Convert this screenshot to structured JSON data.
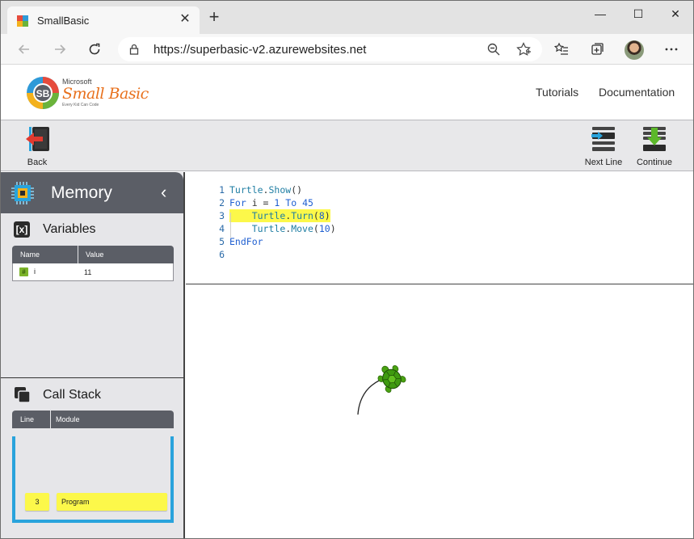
{
  "browser": {
    "tab_title": "SmallBasic",
    "url": "https://superbasic-v2.azurewebsites.net",
    "tab_close_glyph": "✕",
    "new_tab_glyph": "+",
    "window_buttons": [
      "—",
      "☐",
      "✕"
    ]
  },
  "site": {
    "logo_brand": "Microsoft",
    "logo_product": "Small Basic",
    "logo_tagline": "Every Kid Can Code",
    "nav": [
      "Tutorials",
      "Documentation"
    ]
  },
  "debug_toolbar": {
    "back_label": "Back",
    "next_line_label": "Next Line",
    "continue_label": "Continue"
  },
  "memory": {
    "title": "Memory",
    "collapse_glyph": "‹",
    "variables": {
      "title": "Variables",
      "icon_text": "[x]",
      "columns": [
        "Name",
        "Value"
      ],
      "rows": [
        {
          "badge": "#",
          "name": "i",
          "value": "11"
        }
      ]
    },
    "call_stack": {
      "title": "Call Stack",
      "columns": [
        "Line",
        "Module"
      ],
      "frames": [
        {
          "line": "3",
          "module": "Program"
        }
      ]
    }
  },
  "editor": {
    "current_line": 3,
    "lines": [
      {
        "num": "1",
        "segments": [
          {
            "t": "Turtle",
            "c": "obj"
          },
          {
            "t": ".",
            "c": "pl"
          },
          {
            "t": "Show",
            "c": "obj"
          },
          {
            "t": "()",
            "c": "pl"
          }
        ]
      },
      {
        "num": "2",
        "segments": [
          {
            "t": "For",
            "c": "kw"
          },
          {
            "t": " i = ",
            "c": "pl"
          },
          {
            "t": "1",
            "c": "num"
          },
          {
            "t": " ",
            "c": "pl"
          },
          {
            "t": "To",
            "c": "kw"
          },
          {
            "t": " ",
            "c": "pl"
          },
          {
            "t": "45",
            "c": "num"
          }
        ]
      },
      {
        "num": "3",
        "segments": [
          {
            "t": "    ",
            "c": "pl"
          },
          {
            "t": "Turtle",
            "c": "obj"
          },
          {
            "t": ".",
            "c": "pl"
          },
          {
            "t": "Turn",
            "c": "obj"
          },
          {
            "t": "(",
            "c": "pl"
          },
          {
            "t": "8",
            "c": "num"
          },
          {
            "t": ")",
            "c": "pl"
          }
        ]
      },
      {
        "num": "4",
        "segments": [
          {
            "t": "    ",
            "c": "pl"
          },
          {
            "t": "Turtle",
            "c": "obj"
          },
          {
            "t": ".",
            "c": "pl"
          },
          {
            "t": "Move",
            "c": "obj"
          },
          {
            "t": "(",
            "c": "pl"
          },
          {
            "t": "10",
            "c": "num"
          },
          {
            "t": ")",
            "c": "pl"
          }
        ]
      },
      {
        "num": "5",
        "segments": [
          {
            "t": "EndFor",
            "c": "kw"
          }
        ]
      },
      {
        "num": "6",
        "segments": []
      }
    ]
  },
  "colors": {
    "highlight": "#fcf84a",
    "panel_header": "#5b5e66",
    "call_stack_border": "#29a3dc",
    "turtle_green": "#4aa312"
  }
}
